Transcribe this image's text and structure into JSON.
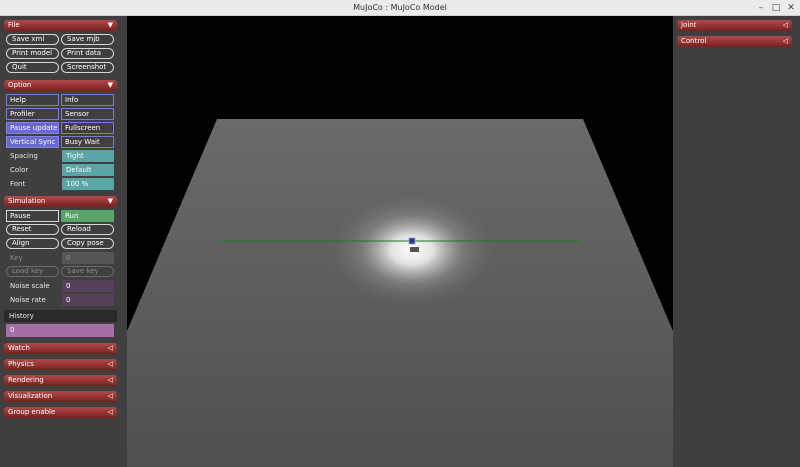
{
  "window": {
    "title": "MuJoCo : MuJoCo Model"
  },
  "left": {
    "file": {
      "header": "File",
      "buttons": [
        "Save xml",
        "Save mjb",
        "Print model",
        "Print data",
        "Quit",
        "Screenshot"
      ]
    },
    "option": {
      "header": "Option",
      "buttons": [
        "Help",
        "Info",
        "Profiler",
        "Sensor",
        "Pause update",
        "Fullscreen",
        "Vertical Sync",
        "Busy Wait"
      ],
      "spacing_label": "Spacing",
      "spacing_value": "Tight",
      "color_label": "Color",
      "color_value": "Default",
      "font_label": "Font",
      "font_value": "100 %"
    },
    "simulation": {
      "header": "Simulation",
      "pause": "Pause",
      "run": "Run",
      "reset": "Reset",
      "reload": "Reload",
      "align": "Align",
      "copy_pose": "Copy pose",
      "key_label": "Key",
      "key_value": "0",
      "load_key": "Load key",
      "save_key": "Save key",
      "noise_scale_label": "Noise scale",
      "noise_scale_value": "0",
      "noise_rate_label": "Noise rate",
      "noise_rate_value": "0",
      "history_label": "History",
      "history_value": "0"
    },
    "sections": [
      "Watch",
      "Physics",
      "Rendering",
      "Visualization",
      "Group enable"
    ]
  },
  "right": {
    "sections": [
      "Joint",
      "Control"
    ]
  },
  "icons": {
    "collapse": "▼",
    "expand": "◁",
    "minimize": "–",
    "maximize": "□",
    "close": "✕"
  },
  "colors": {
    "panel": "#3f3f3f",
    "header": "#8c2d2d",
    "selected": "#6868d0",
    "teal": "#5aa6a6",
    "run_green": "#5aa46a",
    "history": "#a66ea6"
  }
}
